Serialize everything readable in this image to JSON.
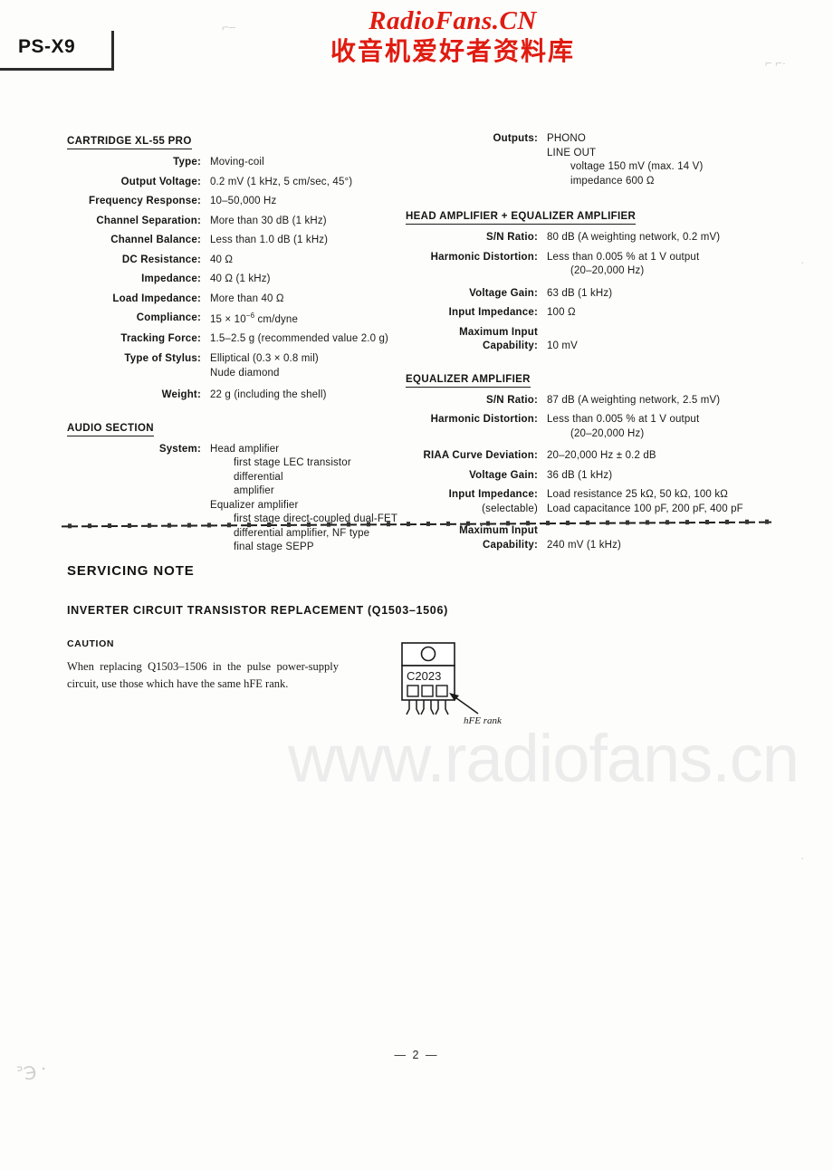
{
  "header": {
    "model": "PS-X9",
    "watermark_latin": "RadioFans.CN",
    "watermark_cjk": "收音机爱好者资料库"
  },
  "watermark_big": "www.radiofans.cn",
  "specs": {
    "left": {
      "sections": [
        {
          "heading": "CARTRIDGE XL-55 PRO",
          "rows": [
            {
              "label": "Type:",
              "value": "Moving-coil"
            },
            {
              "label": "Output Voltage:",
              "value": "0.2 mV (1 kHz, 5 cm/sec, 45°)"
            },
            {
              "label": "Frequency Response:",
              "value": "10–50,000 Hz"
            },
            {
              "label": "Channel Separation:",
              "value": "More than 30 dB (1 kHz)"
            },
            {
              "label": "Channel Balance:",
              "value": "Less than 1.0 dB (1 kHz)"
            },
            {
              "label": "DC Resistance:",
              "value": "40 Ω"
            },
            {
              "label": "Impedance:",
              "value": "40 Ω (1 kHz)"
            },
            {
              "label": "Load Impedance:",
              "value": "More than 40 Ω"
            },
            {
              "label": "Compliance:",
              "value": "15 × 10",
              "exponent": "−6",
              "value_tail": " cm/dyne"
            },
            {
              "label": "Tracking Force:",
              "value": "1.5–2.5 g (recommended value 2.0 g)"
            },
            {
              "label": "Type of Stylus:",
              "value": "Elliptical (0.3 × 0.8 mil)",
              "cont": "Nude diamond"
            },
            {
              "label": "Weight:",
              "value": "22 g (including the shell)"
            }
          ]
        },
        {
          "heading": "AUDIO SECTION",
          "rows": [
            {
              "label": "System:",
              "value": "Head amplifier",
              "subs": [
                "first stage LEC transistor differential",
                "amplifier"
              ],
              "cont2": "Equalizer amplifier",
              "subs2": [
                "first stage direct-coupled dual-FET",
                "differential amplifier, NF type",
                "final stage SEPP"
              ]
            }
          ]
        }
      ]
    },
    "right": {
      "outputs": {
        "label": "Outputs:",
        "value": "PHONO",
        "cont": "LINE OUT",
        "subs": [
          "voltage 150 mV (max. 14 V)",
          "impedance 600 Ω"
        ]
      },
      "sections": [
        {
          "heading": "HEAD AMPLIFIER + EQUALIZER AMPLIFIER",
          "rows": [
            {
              "label": "S/N Ratio:",
              "value": "80 dB (A weighting network, 0.2 mV)"
            },
            {
              "label": "Harmonic Distortion:",
              "value": "Less than 0.005 % at 1 V output",
              "sub": "(20–20,000 Hz)"
            },
            {
              "label": "Voltage Gain:",
              "value": "63 dB (1 kHz)"
            },
            {
              "label": "Input Impedance:",
              "value": "100 Ω"
            },
            {
              "label": "Maximum Input",
              "label2": "Capability:",
              "value": "10 mV"
            }
          ]
        },
        {
          "heading": "EQUALIZER AMPLIFIER",
          "rows": [
            {
              "label": "S/N Ratio:",
              "value": "87 dB (A weighting network, 2.5 mV)"
            },
            {
              "label": "Harmonic Distortion:",
              "value": "Less than 0.005 % at 1 V output",
              "sub": "(20–20,000 Hz)"
            },
            {
              "label": "RIAA Curve Deviation:",
              "value": "20–20,000 Hz ± 0.2 dB"
            },
            {
              "label": "Voltage Gain:",
              "value": "36 dB (1 kHz)"
            },
            {
              "label": "Input Impedance:",
              "label2": "(selectable)",
              "value": "Load resistance 25 kΩ, 50 kΩ, 100 kΩ",
              "cont": "Load capacitance 100 pF, 200 pF, 400 pF"
            },
            {
              "label": "Maximum Input",
              "label2": "Capability:",
              "value": "240 mV (1 kHz)"
            }
          ]
        }
      ]
    }
  },
  "servicing": {
    "title": "SERVICING NOTE",
    "subtitle": "INVERTER CIRCUIT TRANSISTOR REPLACEMENT (Q1503–1506)",
    "caution_heading": "CAUTION",
    "caution_body": "When replacing Q1503–1506 in the pulse power-supply circuit, use those which have the same hFE rank.",
    "figure": {
      "part_number": "C2023",
      "annotation": "hFE rank"
    }
  },
  "footer": {
    "page_number": "—  2  —"
  }
}
